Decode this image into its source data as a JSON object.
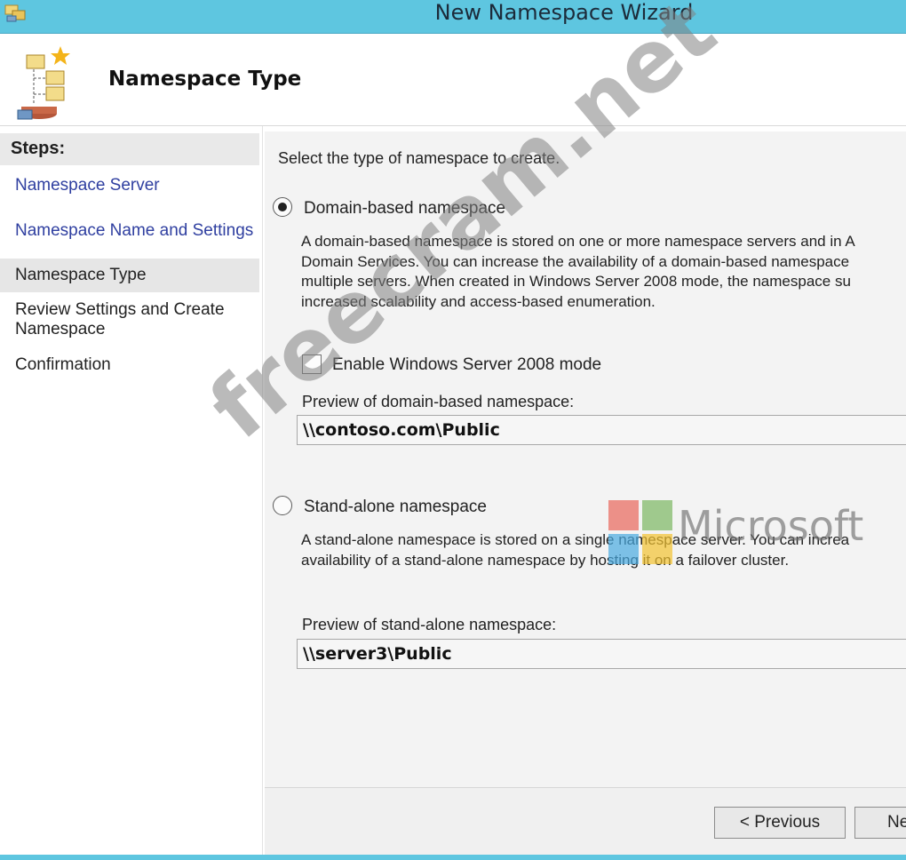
{
  "window": {
    "title": "New Namespace Wizard"
  },
  "header": {
    "page_title": "Namespace Type"
  },
  "steps": {
    "heading": "Steps:",
    "items": [
      {
        "label": "Namespace Server",
        "state": "link"
      },
      {
        "label": "Namespace Name and Settings",
        "state": "link"
      },
      {
        "label": "Namespace Type",
        "state": "current"
      },
      {
        "label": "Review Settings and Create Namespace",
        "state": "plain"
      },
      {
        "label": "Confirmation",
        "state": "plain"
      }
    ]
  },
  "main": {
    "instruction": "Select the type of namespace to create.",
    "domain_option": {
      "label": "Domain-based namespace",
      "selected": true,
      "description_lines": [
        "A domain-based namespace is stored on one or more namespace servers and in A",
        "Domain Services. You can increase the availability of a domain-based namespace",
        "multiple servers. When created in Windows Server 2008 mode, the namespace su",
        "increased scalability and access-based enumeration."
      ],
      "checkbox_label": "Enable Windows Server 2008 mode",
      "checkbox_checked": false,
      "preview_label": "Preview of domain-based namespace:",
      "preview_value": "\\\\contoso.com\\Public"
    },
    "standalone_option": {
      "label": "Stand-alone namespace",
      "selected": false,
      "description_lines": [
        "A stand-alone namespace is stored on a single namespace server. You can increa",
        "availability of a stand-alone namespace by hosting it on a failover cluster."
      ],
      "preview_label": "Preview of stand-alone namespace:",
      "preview_value": "\\\\server3\\Public"
    }
  },
  "footer": {
    "previous_label": "< Previous",
    "next_label": "Ne"
  },
  "watermarks": {
    "site_text": "freecram.net",
    "logo_text": "Microsoft"
  },
  "colors": {
    "titlebar": "#5ec6e0",
    "link": "#2f3fa0"
  }
}
